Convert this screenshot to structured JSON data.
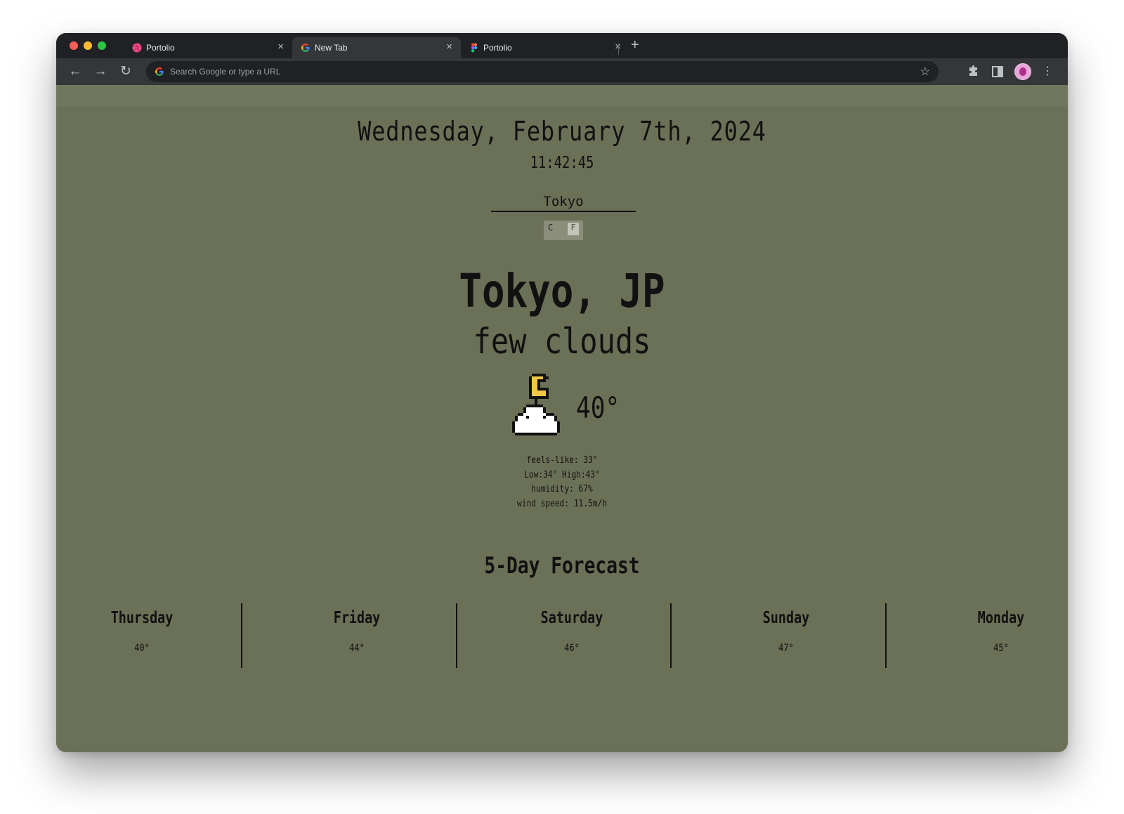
{
  "browser": {
    "tabs": [
      {
        "title": "Portolio",
        "favicon": "dribbble-icon",
        "active": false
      },
      {
        "title": "New Tab",
        "favicon": "google-icon",
        "active": true
      },
      {
        "title": "Portolio",
        "favicon": "figma-icon",
        "active": false
      }
    ],
    "new_tab": "+",
    "omnibox_placeholder": "Search Google or type a URL",
    "colors": {
      "titlebar": "#202124",
      "toolbar": "#35363a",
      "page_bg": "#6b7157"
    }
  },
  "app": {
    "date": "Wednesday, February 7th, 2024",
    "time": "11:42:45",
    "city_input_value": "Tokyo",
    "units": {
      "celsius": "C",
      "fahrenheit": "F"
    },
    "location": "Tokyo, JP",
    "condition": "few clouds",
    "weather_icon": "moon-cloud-icon",
    "temperature": "40°",
    "details": {
      "feels_like": "feels-like: 33°",
      "low_high": "Low:34° High:43°",
      "humidity": "humidity: 67%",
      "wind": "wind speed: 11.5m/h"
    },
    "forecast_title": "5-Day Forecast",
    "forecast": [
      {
        "day": "Thursday",
        "temp": "40°"
      },
      {
        "day": "Friday",
        "temp": "44°"
      },
      {
        "day": "Saturday",
        "temp": "46°"
      },
      {
        "day": "Sunday",
        "temp": "47°"
      },
      {
        "day": "Monday",
        "temp": "45°"
      }
    ]
  }
}
